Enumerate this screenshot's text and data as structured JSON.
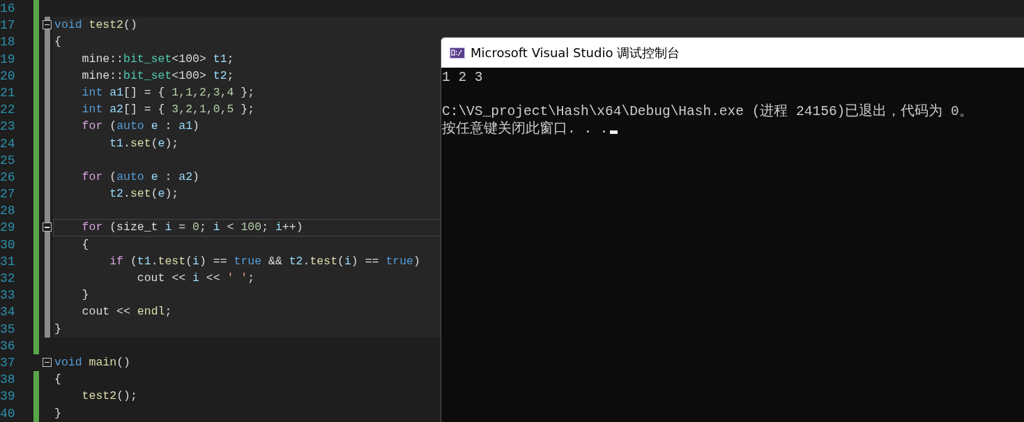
{
  "editor": {
    "lines": [
      {
        "number": "16",
        "changed": true,
        "collapsible": false,
        "scope": false,
        "current": false
      },
      {
        "number": "17",
        "changed": true,
        "collapsible": true,
        "scope": true,
        "current": false,
        "tokens": [
          {
            "kind": "kw",
            "text": "void "
          },
          {
            "kind": "fn",
            "text": "test2"
          },
          {
            "kind": "plain",
            "text": "()"
          }
        ]
      },
      {
        "number": "18",
        "changed": true,
        "collapsible": false,
        "scope": true,
        "current": false,
        "tokens": [
          {
            "kind": "plain",
            "text": "{"
          }
        ]
      },
      {
        "number": "19",
        "changed": true,
        "collapsible": false,
        "scope": true,
        "current": false,
        "tokens": [
          {
            "kind": "plain",
            "text": "    mine::"
          },
          {
            "kind": "type",
            "text": "bit_set"
          },
          {
            "kind": "plain",
            "text": "<100> "
          },
          {
            "kind": "var",
            "text": "t1"
          },
          {
            "kind": "plain",
            "text": ";"
          }
        ]
      },
      {
        "number": "20",
        "changed": true,
        "collapsible": false,
        "scope": true,
        "current": false,
        "tokens": [
          {
            "kind": "plain",
            "text": "    mine::"
          },
          {
            "kind": "type",
            "text": "bit_set"
          },
          {
            "kind": "plain",
            "text": "<100> "
          },
          {
            "kind": "var",
            "text": "t2"
          },
          {
            "kind": "plain",
            "text": ";"
          }
        ]
      },
      {
        "number": "21",
        "changed": true,
        "collapsible": false,
        "scope": true,
        "current": false,
        "tokens": [
          {
            "kind": "kw",
            "text": "    int "
          },
          {
            "kind": "var",
            "text": "a1"
          },
          {
            "kind": "plain",
            "text": "[] = { "
          },
          {
            "kind": "num",
            "text": "1,1,2,3,4"
          },
          {
            "kind": "plain",
            "text": " };"
          }
        ]
      },
      {
        "number": "22",
        "changed": true,
        "collapsible": false,
        "scope": true,
        "current": false,
        "tokens": [
          {
            "kind": "kw",
            "text": "    int "
          },
          {
            "kind": "var",
            "text": "a2"
          },
          {
            "kind": "plain",
            "text": "[] = { "
          },
          {
            "kind": "num",
            "text": "3,2,1,0,5"
          },
          {
            "kind": "plain",
            "text": " };"
          }
        ]
      },
      {
        "number": "23",
        "changed": true,
        "collapsible": false,
        "scope": true,
        "current": false,
        "tokens": [
          {
            "kind": "ctl",
            "text": "    for"
          },
          {
            "kind": "plain",
            "text": " ("
          },
          {
            "kind": "kw",
            "text": "auto "
          },
          {
            "kind": "var",
            "text": "e"
          },
          {
            "kind": "plain",
            "text": " : "
          },
          {
            "kind": "var",
            "text": "a1"
          },
          {
            "kind": "plain",
            "text": ")"
          }
        ]
      },
      {
        "number": "24",
        "changed": true,
        "collapsible": false,
        "scope": true,
        "current": false,
        "tokens": [
          {
            "kind": "var",
            "text": "        t1"
          },
          {
            "kind": "plain",
            "text": "."
          },
          {
            "kind": "fn",
            "text": "set"
          },
          {
            "kind": "plain",
            "text": "("
          },
          {
            "kind": "var",
            "text": "e"
          },
          {
            "kind": "plain",
            "text": ");"
          }
        ]
      },
      {
        "number": "25",
        "changed": true,
        "collapsible": false,
        "scope": true,
        "current": false
      },
      {
        "number": "26",
        "changed": true,
        "collapsible": false,
        "scope": true,
        "current": false,
        "tokens": [
          {
            "kind": "ctl",
            "text": "    for"
          },
          {
            "kind": "plain",
            "text": " ("
          },
          {
            "kind": "kw",
            "text": "auto "
          },
          {
            "kind": "var",
            "text": "e"
          },
          {
            "kind": "plain",
            "text": " : "
          },
          {
            "kind": "var",
            "text": "a2"
          },
          {
            "kind": "plain",
            "text": ")"
          }
        ]
      },
      {
        "number": "27",
        "changed": true,
        "collapsible": false,
        "scope": true,
        "current": false,
        "tokens": [
          {
            "kind": "var",
            "text": "        t2"
          },
          {
            "kind": "plain",
            "text": "."
          },
          {
            "kind": "fn",
            "text": "set"
          },
          {
            "kind": "plain",
            "text": "("
          },
          {
            "kind": "var",
            "text": "e"
          },
          {
            "kind": "plain",
            "text": ");"
          }
        ]
      },
      {
        "number": "28",
        "changed": true,
        "collapsible": false,
        "scope": true,
        "current": false
      },
      {
        "number": "29",
        "changed": true,
        "collapsible": true,
        "scope": true,
        "current": true,
        "tokens": [
          {
            "kind": "ctl",
            "text": "    for"
          },
          {
            "kind": "plain",
            "text": " (size_t "
          },
          {
            "kind": "var",
            "text": "i"
          },
          {
            "kind": "plain",
            "text": " = "
          },
          {
            "kind": "num",
            "text": "0"
          },
          {
            "kind": "plain",
            "text": "; "
          },
          {
            "kind": "var",
            "text": "i"
          },
          {
            "kind": "plain",
            "text": " < "
          },
          {
            "kind": "num",
            "text": "100"
          },
          {
            "kind": "plain",
            "text": "; "
          },
          {
            "kind": "var",
            "text": "i"
          },
          {
            "kind": "plain",
            "text": "++)"
          }
        ]
      },
      {
        "number": "30",
        "changed": true,
        "collapsible": false,
        "scope": true,
        "current": false,
        "tokens": [
          {
            "kind": "plain",
            "text": "    {"
          }
        ]
      },
      {
        "number": "31",
        "changed": true,
        "collapsible": false,
        "scope": true,
        "current": false,
        "tokens": [
          {
            "kind": "ctl",
            "text": "        if"
          },
          {
            "kind": "plain",
            "text": " ("
          },
          {
            "kind": "var",
            "text": "t1"
          },
          {
            "kind": "plain",
            "text": "."
          },
          {
            "kind": "fn",
            "text": "test"
          },
          {
            "kind": "plain",
            "text": "("
          },
          {
            "kind": "var",
            "text": "i"
          },
          {
            "kind": "plain",
            "text": ") == "
          },
          {
            "kind": "kw",
            "text": "true"
          },
          {
            "kind": "plain",
            "text": " && "
          },
          {
            "kind": "var",
            "text": "t2"
          },
          {
            "kind": "plain",
            "text": "."
          },
          {
            "kind": "fn",
            "text": "test"
          },
          {
            "kind": "plain",
            "text": "("
          },
          {
            "kind": "var",
            "text": "i"
          },
          {
            "kind": "plain",
            "text": ") == "
          },
          {
            "kind": "kw",
            "text": "true"
          },
          {
            "kind": "plain",
            "text": ")"
          }
        ]
      },
      {
        "number": "32",
        "changed": true,
        "collapsible": false,
        "scope": true,
        "current": false,
        "tokens": [
          {
            "kind": "plain",
            "text": "            cout << "
          },
          {
            "kind": "var",
            "text": "i"
          },
          {
            "kind": "plain",
            "text": " << "
          },
          {
            "kind": "str",
            "text": "' '"
          },
          {
            "kind": "plain",
            "text": ";"
          }
        ]
      },
      {
        "number": "33",
        "changed": true,
        "collapsible": false,
        "scope": true,
        "current": false,
        "tokens": [
          {
            "kind": "plain",
            "text": "    }"
          }
        ]
      },
      {
        "number": "34",
        "changed": true,
        "collapsible": false,
        "scope": true,
        "current": false,
        "tokens": [
          {
            "kind": "plain",
            "text": "    cout << "
          },
          {
            "kind": "fn",
            "text": "endl"
          },
          {
            "kind": "plain",
            "text": ";"
          }
        ]
      },
      {
        "number": "35",
        "changed": true,
        "collapsible": false,
        "scope": true,
        "current": false,
        "tokens": [
          {
            "kind": "plain",
            "text": "}"
          }
        ]
      },
      {
        "number": "36",
        "changed": true,
        "collapsible": false,
        "scope": false,
        "current": false
      },
      {
        "number": "37",
        "changed": false,
        "collapsible": true,
        "scope": false,
        "current": false,
        "tokens": [
          {
            "kind": "kw",
            "text": "void "
          },
          {
            "kind": "fn",
            "text": "main"
          },
          {
            "kind": "plain",
            "text": "()"
          }
        ]
      },
      {
        "number": "38",
        "changed": true,
        "collapsible": false,
        "scope": false,
        "current": false,
        "tokens": [
          {
            "kind": "plain",
            "text": "{"
          }
        ]
      },
      {
        "number": "39",
        "changed": true,
        "collapsible": false,
        "scope": false,
        "current": false,
        "tokens": [
          {
            "kind": "fn",
            "text": "    test2"
          },
          {
            "kind": "plain",
            "text": "();"
          }
        ]
      },
      {
        "number": "40",
        "changed": true,
        "collapsible": false,
        "scope": false,
        "current": false,
        "tokens": [
          {
            "kind": "plain",
            "text": "}"
          }
        ]
      }
    ]
  },
  "console": {
    "title": "Microsoft Visual Studio 调试控制台",
    "output": [
      "1 2 3",
      "C:\\VS_project\\Hash\\x64\\Debug\\Hash.exe (进程 24156)已退出，代码为 0。",
      "按任意键关闭此窗口. . ."
    ],
    "cursor": true
  }
}
